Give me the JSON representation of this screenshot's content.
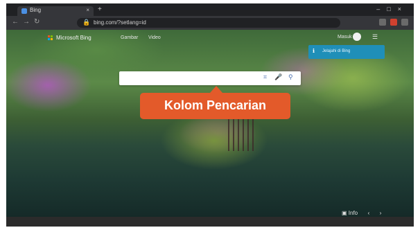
{
  "browser": {
    "tab_title": "Bing",
    "tab_close": "×",
    "new_tab": "+",
    "window_controls": "–□×",
    "nav": {
      "back": "←",
      "forward": "→",
      "reload": "↻"
    },
    "address_icon": "🔒",
    "address": "bing.com/?setlang=id"
  },
  "page": {
    "logo_text": "Microsoft Bing",
    "top_links": [
      "Gambar",
      "Video"
    ],
    "signin": "Masuk",
    "menu": "☰",
    "notice_icon": "ℹ",
    "notice_text": "Jelajahi di Bing"
  },
  "search": {
    "placeholder": "",
    "icons": {
      "visual": "⌗",
      "mic": "🎤",
      "submit": "⚲"
    }
  },
  "callout": {
    "label": "Kolom Pencarian"
  },
  "bottom": {
    "items": [
      "▣ Info",
      "‹",
      "›"
    ]
  },
  "taskbar": {
    "text": ""
  },
  "colors": {
    "accent": "#e35a2a",
    "notice": "#1f8fb8",
    "ms_red": "#f35325",
    "ms_green": "#81bc06",
    "ms_blue": "#05a6f0",
    "ms_yellow": "#ffba08"
  }
}
